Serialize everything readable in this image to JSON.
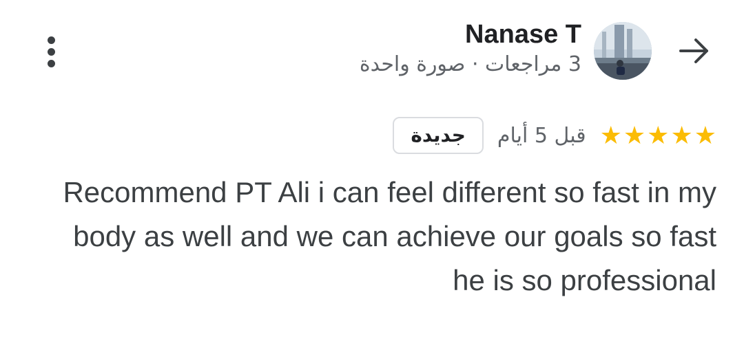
{
  "reviewer": {
    "name": "Nanase T",
    "meta": "3 مراجعات · صورة واحدة"
  },
  "review": {
    "stars": 5,
    "time_ago": "قبل 5 أيام",
    "badge": "جديدة",
    "text": "Recommend PT Ali i can feel different so fast in my body as well and we can achieve our goals so fast he is so professional"
  },
  "colors": {
    "star": "#fbbc04",
    "name": "#202124",
    "secondary": "#5f6368",
    "body_text": "#3c4043",
    "badge_border": "#dadce0"
  },
  "icons": {
    "more": "more-vert-icon",
    "navigate": "arrow-forward-icon",
    "star": "star-icon"
  }
}
